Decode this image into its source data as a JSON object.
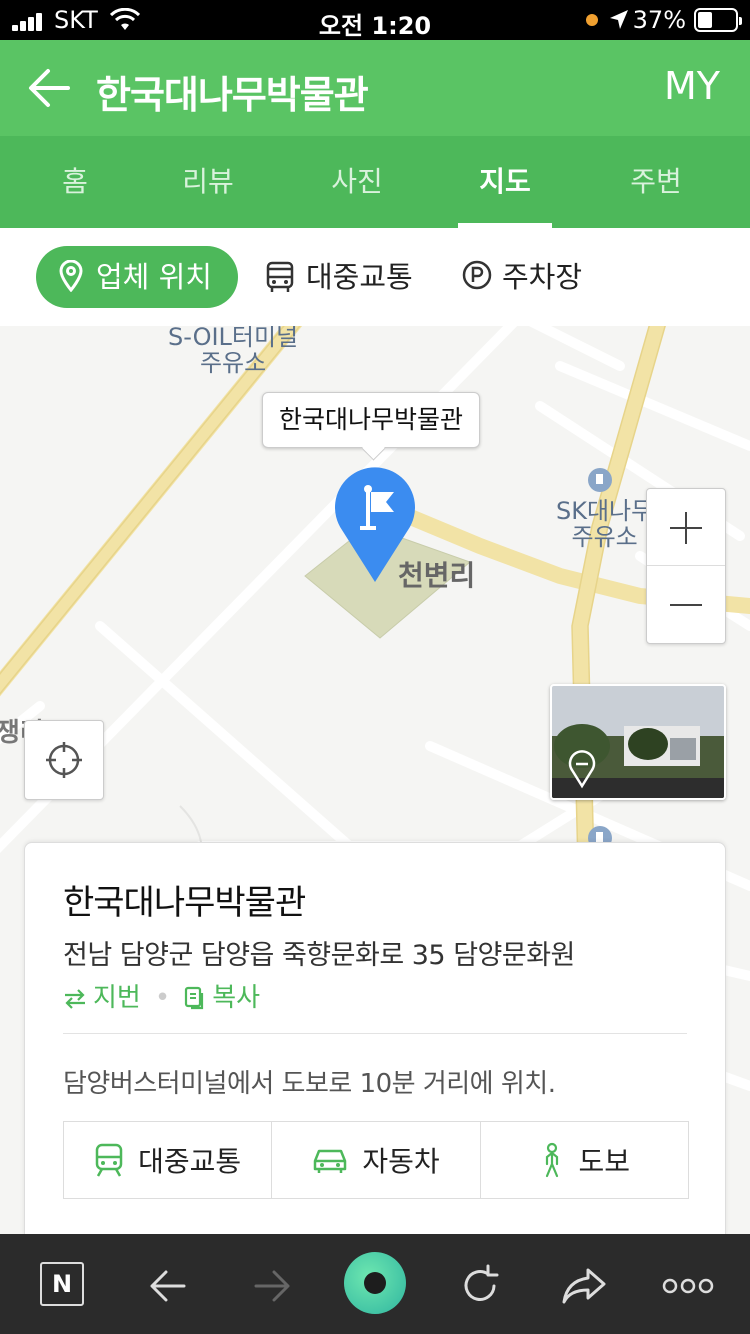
{
  "status_bar": {
    "carrier": "SKT",
    "time": "오전 1:20",
    "battery": "37%"
  },
  "header": {
    "title": "한국대나무박물관",
    "my_label": "MY"
  },
  "tabs": [
    {
      "label": "홈",
      "active": false
    },
    {
      "label": "리뷰",
      "active": false
    },
    {
      "label": "사진",
      "active": false
    },
    {
      "label": "지도",
      "active": true
    },
    {
      "label": "주변",
      "active": false
    }
  ],
  "filters": {
    "location": "업체 위치",
    "transit": "대중교통",
    "parking": "주차장"
  },
  "map": {
    "callout": "한국대나무박물관",
    "labels": {
      "soil_line1": "S-OIL터미널",
      "soil_line2": "주유소",
      "sk_line1": "SK대나무",
      "sk_line2": "주유소",
      "village": "천변리",
      "left_edge": "쟁리"
    }
  },
  "card": {
    "name": "한국대나무박물관",
    "address": "전남 담양군 담양읍 죽향문화로 35 담양문화원",
    "lot_number": "지번",
    "copy": "복사",
    "description": "담양버스터미널에서 도보로 10분 거리에 위치.",
    "modes": {
      "transit": "대중교통",
      "car": "자동차",
      "walk": "도보"
    }
  },
  "colors": {
    "brand_green": "#5ac464",
    "tab_green": "#4db85a",
    "pin_blue": "#3b8cf0"
  }
}
